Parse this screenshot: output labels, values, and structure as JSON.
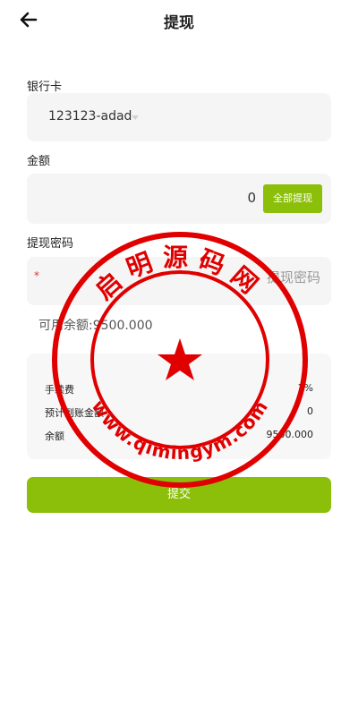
{
  "header": {
    "title": "提现"
  },
  "form": {
    "bank_label": "银行卡",
    "bank_value": "123123-adad",
    "amount_label": "金额",
    "amount_value": "0",
    "all_button": "全部提现",
    "password_label": "提现密码",
    "required_mark": "*",
    "password_placeholder": "提现密码",
    "available_label": "可用余额:",
    "available_value": "9500.000"
  },
  "summary": {
    "rows": [
      {
        "label": "手续费",
        "value": "1%"
      },
      {
        "label": "预计到账金额",
        "value": "0"
      },
      {
        "label": "余额",
        "value": "9500.000"
      }
    ]
  },
  "submit_label": "提交",
  "watermark": {
    "top_text": "启明源码网",
    "bottom_text": "www.qimingym.com",
    "color": "#e00000"
  },
  "colors": {
    "accent": "#8bbf0a",
    "required": "#dd3333"
  }
}
